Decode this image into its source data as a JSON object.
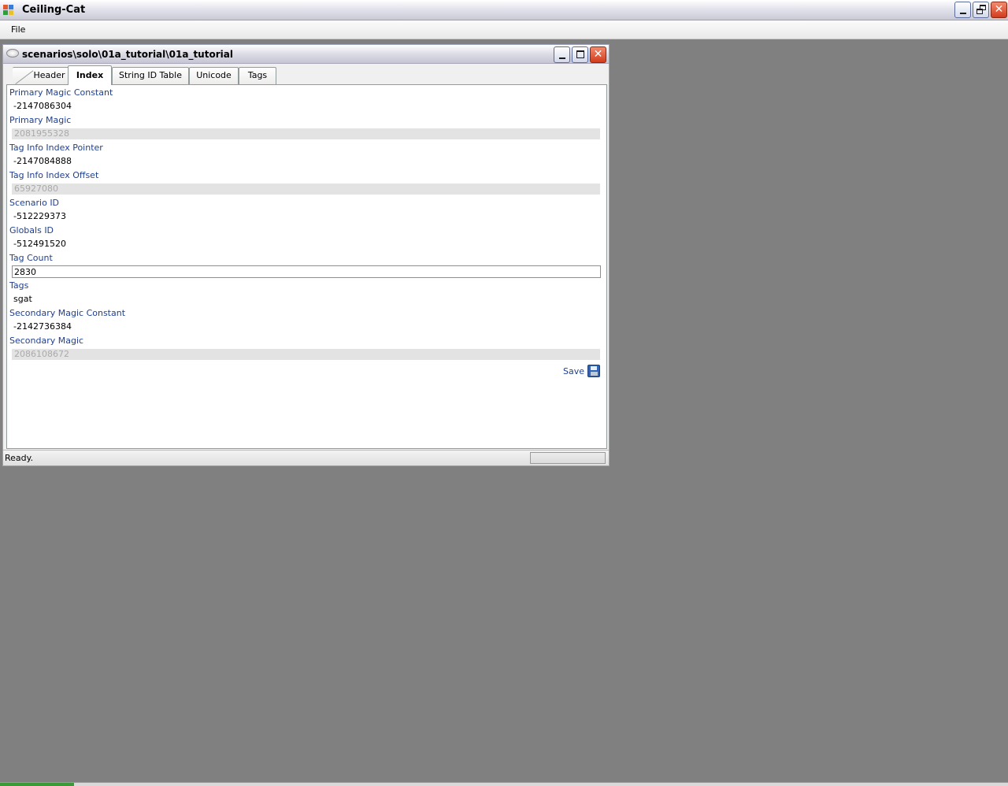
{
  "app": {
    "title": "Ceiling-Cat",
    "menu": [
      "File"
    ]
  },
  "child": {
    "title": "scenarios\\solo\\01a_tutorial\\01a_tutorial",
    "tabs": [
      {
        "label": "Header"
      },
      {
        "label": "Index",
        "active": true
      },
      {
        "label": "String ID Table"
      },
      {
        "label": "Unicode"
      },
      {
        "label": "Tags"
      }
    ],
    "fields": [
      {
        "label": "Primary Magic Constant",
        "value": "-2147086304",
        "style": "plain"
      },
      {
        "label": "Primary Magic",
        "value": "2081955328",
        "style": "readonly"
      },
      {
        "label": "Tag Info Index Pointer",
        "value": "-2147084888",
        "style": "plain"
      },
      {
        "label": "Tag Info Index Offset",
        "value": "65927080",
        "style": "readonly"
      },
      {
        "label": "Scenario ID",
        "value": "-512229373",
        "style": "plain"
      },
      {
        "label": "Globals ID",
        "value": "-512491520",
        "style": "plain"
      },
      {
        "label": "Tag Count",
        "value": "2830",
        "style": "input"
      },
      {
        "label": "Tags",
        "value": "sgat",
        "style": "plain"
      },
      {
        "label": "Secondary Magic Constant",
        "value": "-2142736384",
        "style": "plain"
      },
      {
        "label": "Secondary Magic",
        "value": "2086108672",
        "style": "readonly"
      }
    ],
    "save_label": "Save",
    "status": "Ready."
  },
  "colors": {
    "label": "#1f3f8f",
    "desktop": "#808080",
    "readonly_bg": "#e3e3e3",
    "readonly_text": "#aaaaaa"
  }
}
